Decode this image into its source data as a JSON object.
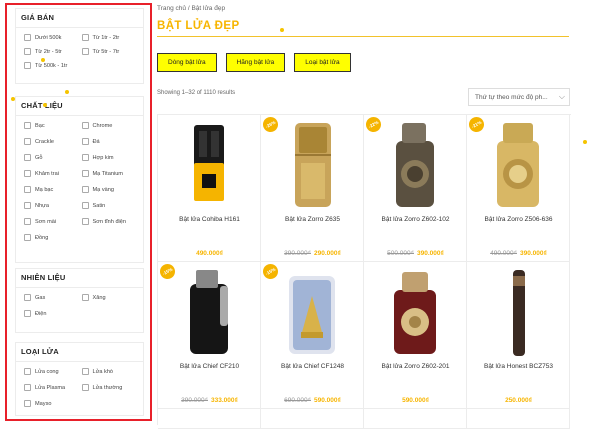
{
  "sidebar": {
    "groups": [
      {
        "title": "GIÁ BÁN",
        "options": [
          "Dưới 500k",
          "Từ 1tr - 2tr",
          "Từ 2tr - 5tr",
          "Từ 5tr - 7tr",
          "Từ 500k - 1tr"
        ]
      },
      {
        "title": "CHẤT LIỆU",
        "options": [
          "Bạc",
          "Chrome",
          "Crackle",
          "Đá",
          "Gỗ",
          "Hợp kim",
          "Khảm trai",
          "Mạ Titanium",
          "Mạ bạc",
          "Mạ vàng",
          "Nhựa",
          "Satin",
          "Sơn mài",
          "Sơn tĩnh điện",
          "Đồng"
        ]
      },
      {
        "title": "NHIÊN LIỆU",
        "options": [
          "Gas",
          "Xăng",
          "Điện"
        ]
      },
      {
        "title": "LOẠI LỬA",
        "options": [
          "Lửa cong",
          "Lửa khò",
          "Lửa Plasma",
          "Lửa thường",
          "Mayso"
        ]
      }
    ]
  },
  "breadcrumb": "Trang chủ / Bật lửa đẹp",
  "page_title": "BẬT LỬA ĐẸP",
  "tabs": [
    "Dòng bật lửa",
    "Hãng bật lửa",
    "Loại bật lửa"
  ],
  "result_count": "Showing 1–32 of 1110 results",
  "sort_label": "Thứ tự theo mức độ ph...",
  "products": [
    {
      "name": "Bật lửa Cohiba H161",
      "old_price": "",
      "price": "490.000₫",
      "badge": ""
    },
    {
      "name": "Bật lửa Zorro Z635",
      "old_price": "390.000₫",
      "price": "290.000₫",
      "badge": "-26%"
    },
    {
      "name": "Bật lửa Zorro Z602-102",
      "old_price": "500.000₫",
      "price": "390.000₫",
      "badge": "-22%"
    },
    {
      "name": "Bật lửa Zorro Z506-636",
      "old_price": "490.000₫",
      "price": "390.000₫",
      "badge": "-21%"
    },
    {
      "name": "Bật lửa Chief CF210",
      "old_price": "390.000₫",
      "price": "333.000₫",
      "badge": "-15%"
    },
    {
      "name": "Bật lửa Chief CF1248",
      "old_price": "690.000₫",
      "price": "590.000₫",
      "badge": "-15%"
    },
    {
      "name": "Bật lửa Zorro Z602-201",
      "old_price": "",
      "price": "590.000₫",
      "badge": ""
    },
    {
      "name": "Bật lửa Honest BCZ753",
      "old_price": "",
      "price": "250.000₫",
      "badge": ""
    }
  ],
  "colors": {
    "accent": "#f7b500",
    "tab_bg": "#ffff00",
    "highlight_border": "#e8202a"
  }
}
